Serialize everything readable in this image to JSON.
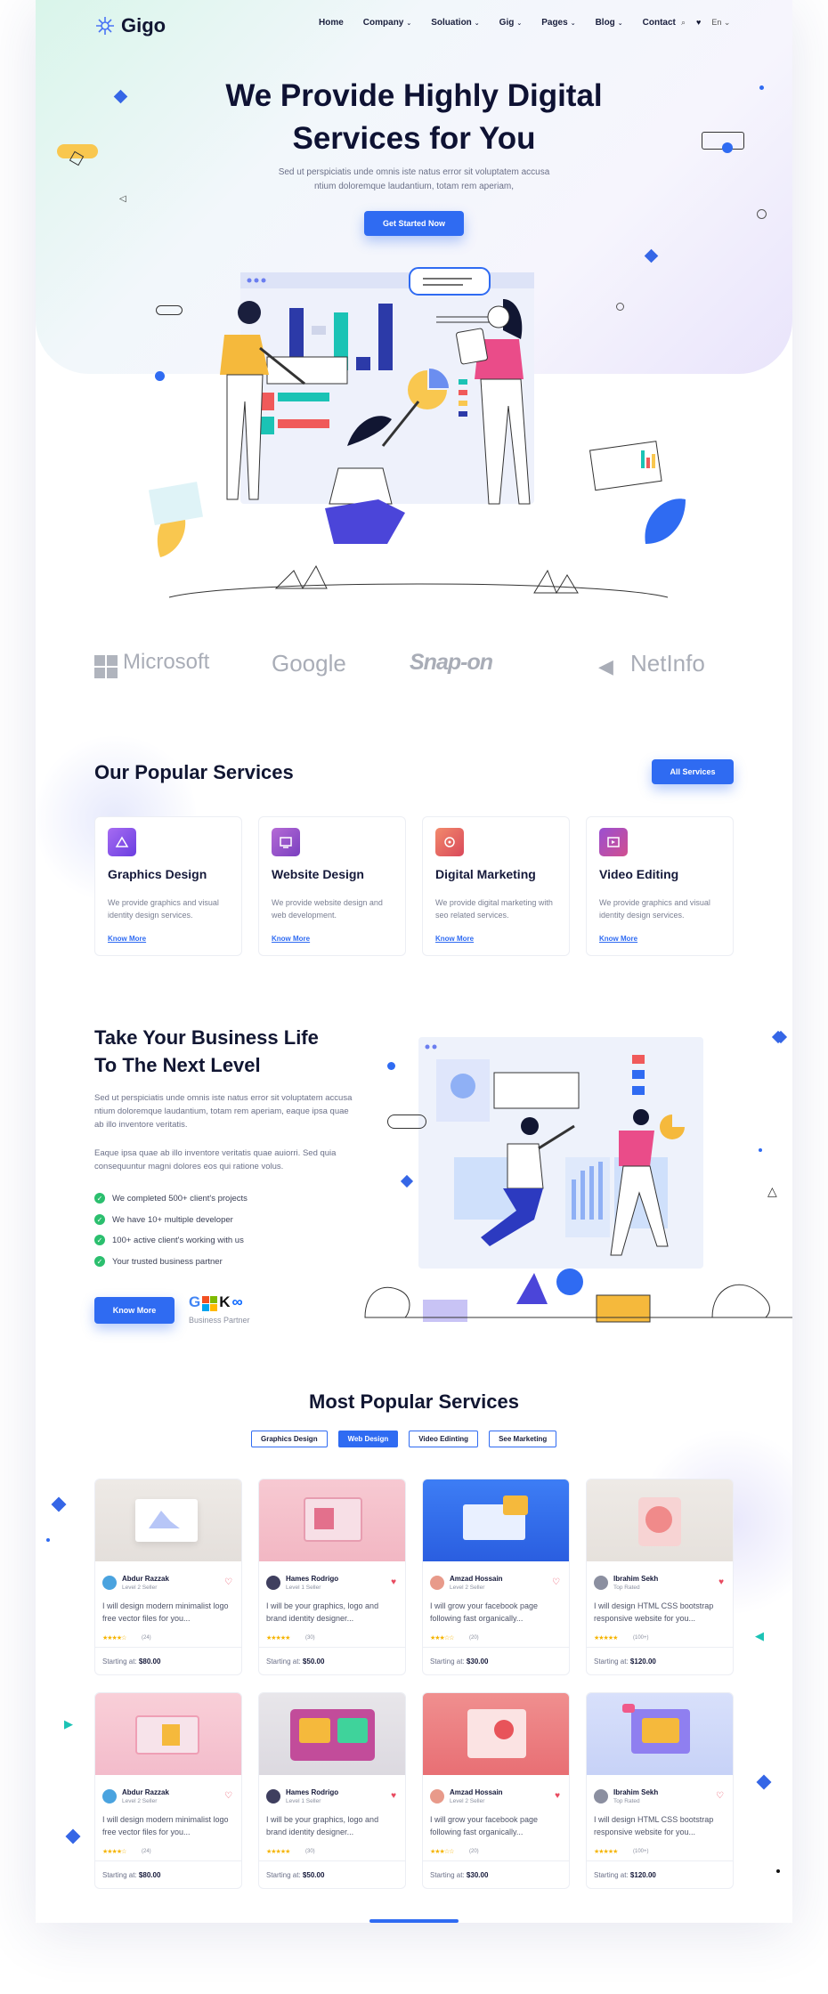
{
  "brand": {
    "name": "Gigo"
  },
  "nav": {
    "items": [
      {
        "label": "Home",
        "dropdown": false
      },
      {
        "label": "Company",
        "dropdown": true
      },
      {
        "label": "Soluation",
        "dropdown": true
      },
      {
        "label": "Gig",
        "dropdown": true
      },
      {
        "label": "Pages",
        "dropdown": true
      },
      {
        "label": "Blog",
        "dropdown": true
      },
      {
        "label": "Contact",
        "dropdown": false
      }
    ],
    "lang": "En"
  },
  "hero": {
    "title_line1": "We Provide Highly Digital",
    "title_line2": "Services for You",
    "text": "Sed ut perspiciatis unde omnis iste natus error sit voluptatem accusa ntium doloremque laudantium, totam rem aperiam,",
    "cta": "Get Started Now"
  },
  "partners": [
    "Microsoft",
    "Google",
    "Snap-on",
    "NetInfo"
  ],
  "popular_services": {
    "title": "Our Popular Services",
    "all_button": "All Services",
    "cards": [
      {
        "title": "Graphics Design",
        "desc": "We provide graphics and visual identity design services.",
        "link": "Know More"
      },
      {
        "title": "Website Design",
        "desc": "We provide website design and web development.",
        "link": "Know More"
      },
      {
        "title": "Digital Marketing",
        "desc": "We provide digital marketing with seo related services.",
        "link": "Know More"
      },
      {
        "title": "Video Editing",
        "desc": "We provide graphics and visual identity design services.",
        "link": "Know More"
      }
    ]
  },
  "business": {
    "title_line1": "Take Your Business Life",
    "title_line2": "To The Next Level",
    "p1": "Sed ut perspiciatis unde omnis iste natus error sit voluptatem accusa ntium doloremque laudantium, totam rem aperiam, eaque ipsa quae ab illo inventore veritatis.",
    "p2": "Eaque ipsa quae ab illo inventore veritatis quae auiorri. Sed quia consequuntur magni dolores eos qui ratione volus.",
    "checks": [
      "We completed 500+ client's projects",
      "We have 10+ multiple developer",
      "100+ active client's working with us",
      "Your trusted business partner"
    ],
    "button": "Know More",
    "partner_caption": "Business Partner"
  },
  "most_popular": {
    "title": "Most Popular Services",
    "tabs": [
      "Graphics Design",
      "Web Design",
      "Video Edinting",
      "See Marketing"
    ],
    "active_tab": "Web Design",
    "gigs": [
      {
        "name": "Abdur Razzak",
        "level": "Level 2 Seller",
        "desc": "I will design modern minimalist logo free vector files for you...",
        "stars": "★★★★☆",
        "reviews": "(24)",
        "price_label": "Starting at:",
        "price": "$80.00",
        "liked": false
      },
      {
        "name": "Hames Rodrigo",
        "level": "Level 1 Seller",
        "desc": "I will be your graphics, logo and brand identity designer...",
        "stars": "★★★★★",
        "reviews": "(30)",
        "price_label": "Starting at:",
        "price": "$50.00",
        "liked": true
      },
      {
        "name": "Amzad Hossain",
        "level": "Level 2 Seller",
        "desc": "I will grow your facebook page following fast organically...",
        "stars": "★★★☆☆",
        "reviews": "(20)",
        "price_label": "Starting at:",
        "price": "$30.00",
        "liked": false
      },
      {
        "name": "Ibrahim Sekh",
        "level": "Top Rated",
        "desc": "I will design HTML CSS bootstrap responsive website for you...",
        "stars": "★★★★★",
        "reviews": "(100+)",
        "price_label": "Starting at:",
        "price": "$120.00",
        "liked": true
      },
      {
        "name": "Abdur Razzak",
        "level": "Level 2 Seller",
        "desc": "I will design modern minimalist logo free vector files for you...",
        "stars": "★★★★☆",
        "reviews": "(24)",
        "price_label": "Starting at:",
        "price": "$80.00",
        "liked": false
      },
      {
        "name": "Hames Rodrigo",
        "level": "Level 1 Seller",
        "desc": "I will be your graphics, logo and brand identity designer...",
        "stars": "★★★★★",
        "reviews": "(30)",
        "price_label": "Starting at:",
        "price": "$50.00",
        "liked": true
      },
      {
        "name": "Amzad Hossain",
        "level": "Level 2 Seller",
        "desc": "I will grow your facebook page following fast organically...",
        "stars": "★★★☆☆",
        "reviews": "(20)",
        "price_label": "Starting at:",
        "price": "$30.00",
        "liked": true
      },
      {
        "name": "Ibrahim Sekh",
        "level": "Top Rated",
        "desc": "I will design HTML CSS bootstrap responsive website for you...",
        "stars": "★★★★★",
        "reviews": "(100+)",
        "price_label": "Starting at:",
        "price": "$120.00",
        "liked": false
      }
    ]
  },
  "colors": {
    "primary": "#2f6bf2",
    "dark": "#111632",
    "green": "#2bbf6e",
    "star": "#f5b400",
    "heart": "#e84a5f"
  }
}
